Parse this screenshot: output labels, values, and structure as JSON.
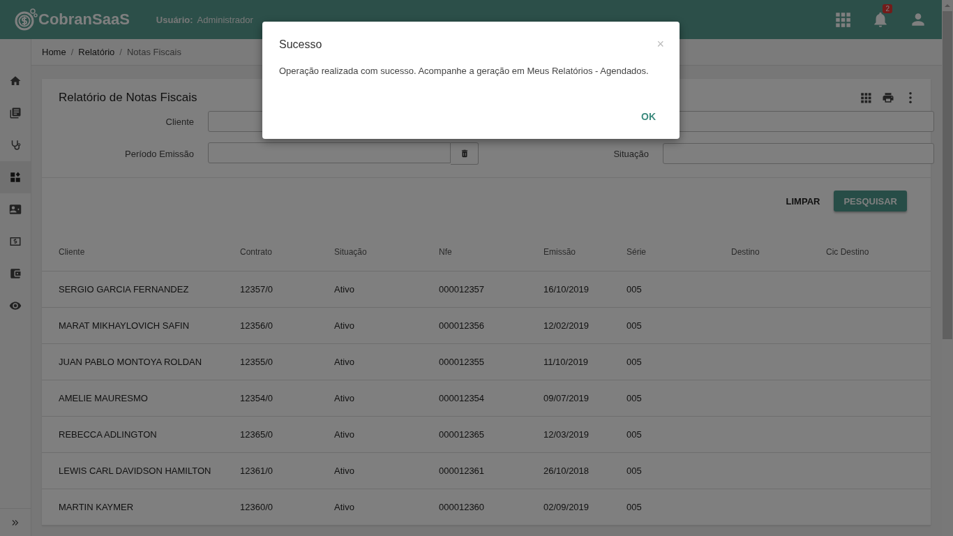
{
  "header": {
    "logo": "CobranSaaS",
    "user_label": "Usuário:",
    "user_value": "Administrador",
    "notification_count": "2"
  },
  "sidebar": {
    "items": [
      {
        "selected": false
      },
      {
        "selected": false
      },
      {
        "selected": false
      },
      {
        "selected": true
      },
      {
        "selected": false
      },
      {
        "selected": false
      },
      {
        "selected": false
      },
      {
        "selected": false
      }
    ]
  },
  "breadcrumb": {
    "separator": "/",
    "items": [
      "Home",
      "Relatório",
      "Notas Fiscais"
    ]
  },
  "card": {
    "title": "Relatório de Notas Fiscais",
    "filters": [
      {
        "label": "Cliente",
        "kind": "text"
      },
      {
        "kind": "text"
      },
      {
        "label": "Período Emissão",
        "kind": "date"
      },
      {
        "label": "Situação",
        "kind": "text"
      }
    ],
    "buttons": [
      {
        "label": "LIMPAR",
        "kind": "flat"
      },
      {
        "label": "PESQUISAR",
        "kind": "raised"
      }
    ]
  },
  "table": {
    "columns": [
      "Cliente",
      "Contrato",
      "Situação",
      "Nfe",
      "Emissão",
      "Série",
      "Destino",
      "Cic Destino"
    ],
    "rows": [
      [
        "SERGIO GARCIA FERNANDEZ",
        "12357/0",
        "Ativo",
        "000012357",
        "16/10/2019",
        "005"
      ],
      [
        "MARAT MIKHAYLOVICH SAFIN",
        "12356/0",
        "Ativo",
        "000012356",
        "12/02/2019",
        "005"
      ],
      [
        "JUAN PABLO MONTOYA ROLDAN",
        "12355/0",
        "Ativo",
        "000012355",
        "11/10/2019",
        "005"
      ],
      [
        "AMELIE MAURESMO",
        "12354/0",
        "Ativo",
        "000012354",
        "09/07/2019",
        "005"
      ],
      [
        "REBECCA ADLINGTON",
        "12365/0",
        "Ativo",
        "000012365",
        "12/03/2019",
        "005"
      ],
      [
        "LEWIS CARL DAVIDSON HAMILTON",
        "12361/0",
        "Ativo",
        "000012361",
        "26/10/2018",
        "005"
      ],
      [
        "MARTIN KAYMER",
        "12360/0",
        "Ativo",
        "000012360",
        "02/09/2019",
        "005"
      ]
    ]
  },
  "dialog": {
    "title": "Sucesso",
    "close": "×",
    "message": "Operação realizada com sucesso. Acompanhe a geração em Meus Relatórios - Agendados.",
    "button": "OK"
  }
}
